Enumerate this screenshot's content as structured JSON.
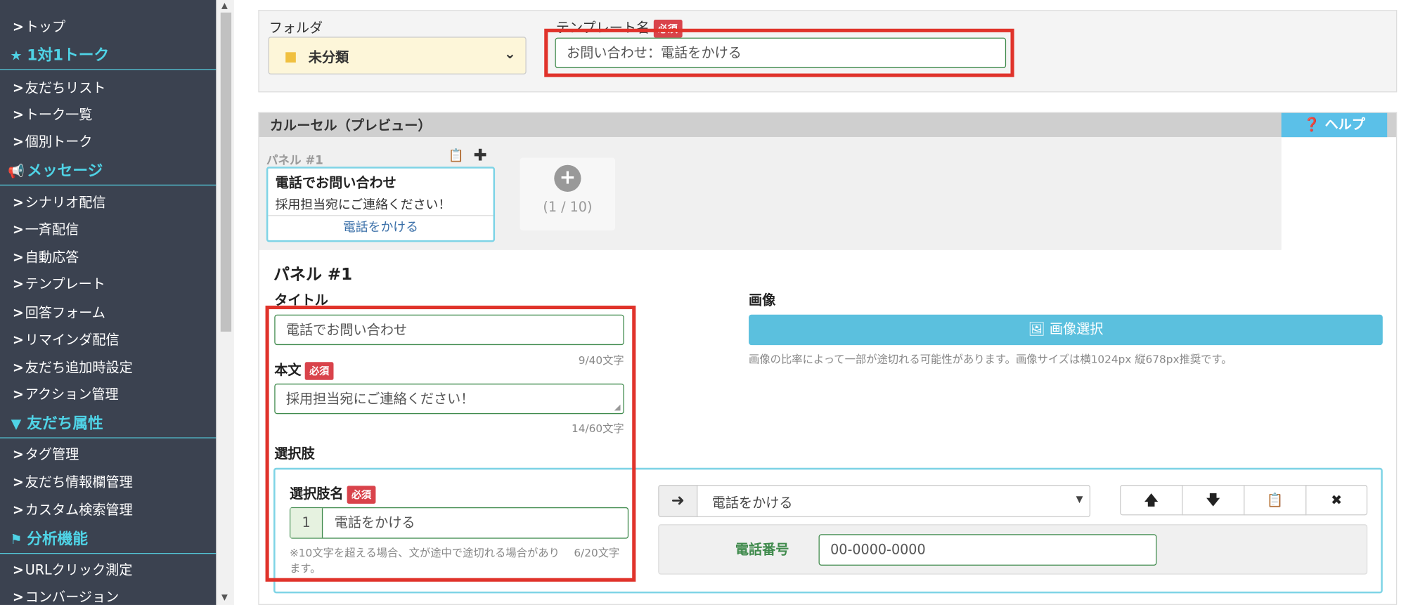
{
  "sidebar": {
    "items": [
      {
        "label": "トップ"
      },
      {
        "label": "1対1トーク",
        "section": true,
        "icon": "star-icon"
      },
      {
        "label": "友だちリスト"
      },
      {
        "label": "トーク一覧"
      },
      {
        "label": "個別トーク"
      },
      {
        "label": "メッセージ",
        "section": true,
        "icon": "megaphone-icon"
      },
      {
        "label": "シナリオ配信"
      },
      {
        "label": "一斉配信"
      },
      {
        "label": "自動応答"
      },
      {
        "label": "テンプレート"
      },
      {
        "label": "回答フォーム"
      },
      {
        "label": "リマインダ配信"
      },
      {
        "label": "友だち追加時設定"
      },
      {
        "label": "アクション管理"
      },
      {
        "label": "友だち属性",
        "section": true,
        "icon": "filter-icon"
      },
      {
        "label": "タグ管理"
      },
      {
        "label": "友だち情報欄管理"
      },
      {
        "label": "カスタム検索管理"
      },
      {
        "label": "分析機能",
        "section": true,
        "icon": "flag-icon"
      },
      {
        "label": "URLクリック測定"
      },
      {
        "label": "コンバージョン"
      }
    ]
  },
  "top_form": {
    "folder_label": "フォルダ",
    "folder_value": "未分類",
    "template_name_label": "テンプレート名",
    "required_badge": "必須",
    "template_name_value": "お問い合わせ：電話をかける"
  },
  "carousel": {
    "header": "カルーセル（プレビュー）",
    "help_label": "ヘルプ",
    "panel_caption": "パネル #1",
    "preview_title": "電話でお問い合わせ",
    "preview_text": "採用担当宛にご連絡ください！",
    "preview_action": "電話をかける",
    "add_counter": "(1 / 10)"
  },
  "editor": {
    "panel_heading": "パネル #1",
    "title_label": "タイトル",
    "title_value": "電話でお問い合わせ",
    "title_count": "9/40文字",
    "body_label": "本文",
    "body_required": "必須",
    "body_value": "採用担当宛にご連絡ください！",
    "body_count": "14/60文字",
    "image_label": "画像",
    "image_button": "画像選択",
    "image_note": "画像の比率によって一部が途切れる可能性があります。画像サイズは横1024px 縦678px推奨です。",
    "choices_label": "選択肢",
    "choice_name_label": "選択肢名",
    "choice_required": "必須",
    "choice_index": "1",
    "choice_value": "電話をかける",
    "choice_note_1": "※10文字を超える場合、文が途中で途切れる場合があり",
    "choice_note_2": "ます。",
    "choice_count": "6/20文字",
    "action_select": "電話をかける",
    "phone_label": "電話番号",
    "phone_value": "00-0000-0000"
  },
  "colors": {
    "sidebar_bg": "#3b4250",
    "accent_cyan": "#4fd3e6",
    "required_red": "#d9434b",
    "highlight_red": "#e0332b",
    "image_button_bg": "#5bc0de",
    "input_border_green": "#3f8a4c"
  }
}
